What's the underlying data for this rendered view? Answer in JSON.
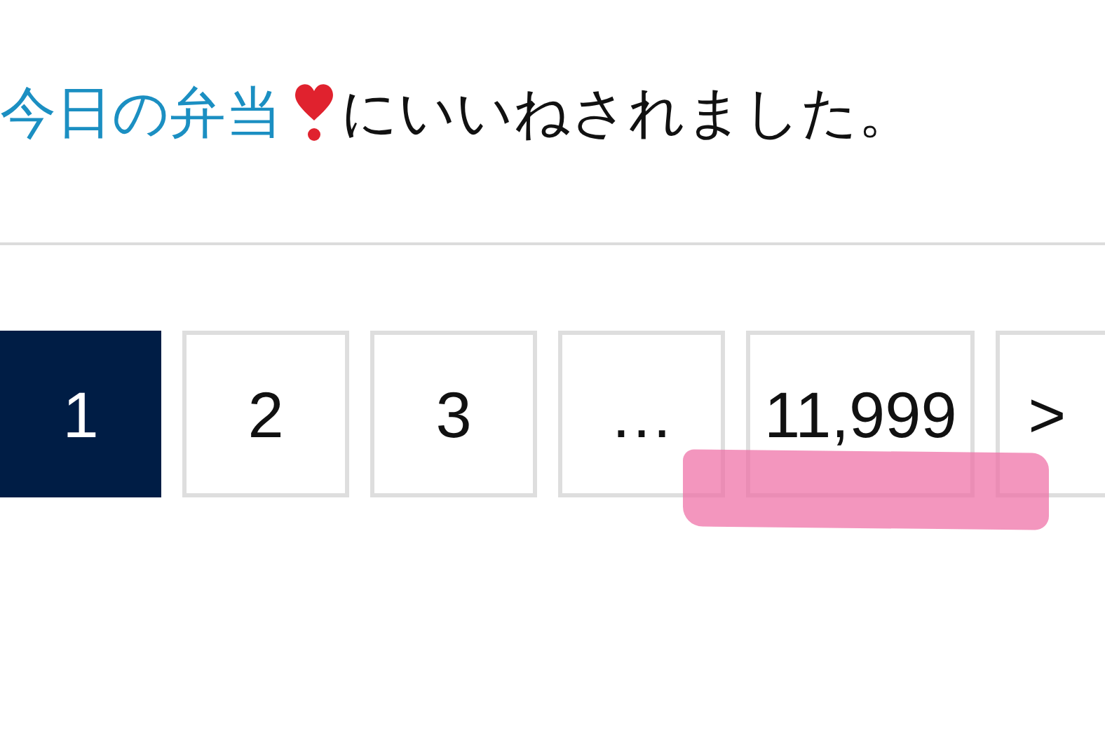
{
  "notification": {
    "link": "今日の弁当",
    "text": "にいいねされました。"
  },
  "pagination": {
    "pages": [
      {
        "label": "1",
        "selected": true
      },
      {
        "label": "2",
        "selected": false
      },
      {
        "label": "3",
        "selected": false
      },
      {
        "label": "…",
        "selected": false
      },
      {
        "label": "11,999",
        "selected": false
      }
    ],
    "next": ">"
  }
}
